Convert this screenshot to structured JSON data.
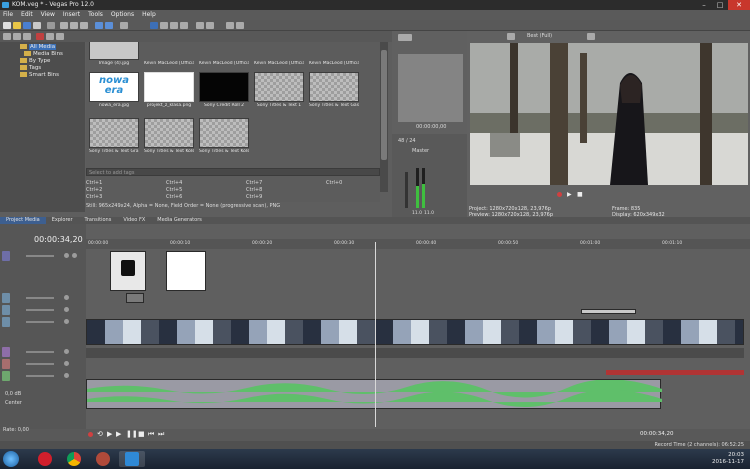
{
  "window": {
    "title": "KOM.veg * - Vegas Pro 12.0"
  },
  "menu": [
    "File",
    "Edit",
    "View",
    "Insert",
    "Tools",
    "Options",
    "Help"
  ],
  "explorer": {
    "tree": [
      {
        "label": "All Media",
        "selected": true
      },
      {
        "label": "Media Bins"
      },
      {
        "label": "By Type"
      },
      {
        "label": "Tags"
      },
      {
        "label": "Smart Bins"
      }
    ],
    "media": [
      {
        "caption": "Image (4).jpg",
        "kind": "photo"
      },
      {
        "caption": "Kevin MacLeod [Official] - Professor Umlaut - inco...",
        "kind": "audio"
      },
      {
        "caption": "Kevin MacLeod [Official] - Professor Umlaut - inco...",
        "kind": "audio"
      },
      {
        "caption": "Kevin MacLeod [Official] - Kyrsa's Theme - incomp...",
        "kind": "audio"
      },
      {
        "caption": "Kevin MacLeod [Official] - Kyrsa's Theme - incomp...",
        "kind": "audio"
      },
      {
        "caption": "nowa_era.jpg",
        "kind": "logo"
      },
      {
        "caption": "projekt_z_klasa.png",
        "kind": "white"
      },
      {
        "caption": "Sony Credit Roll 2",
        "kind": "black"
      },
      {
        "caption": "Sony Titles & Text 1",
        "kind": "checker"
      },
      {
        "caption": "Sony Titles & Text Gasi rady?",
        "kind": "checker"
      },
      {
        "caption": "Sony Titles & Text Gra Miejska",
        "kind": "checker"
      },
      {
        "caption": "Sony Titles & Text Kolska",
        "kind": "checker"
      },
      {
        "caption": "Sony Titles & Text Kolska",
        "kind": "checker"
      }
    ],
    "logo_text": "nowa\nera",
    "tags_placeholder": "Select to add tags",
    "hotkeys": [
      "Ctrl+1",
      "Ctrl+2",
      "Ctrl+3",
      "Ctrl+4",
      "Ctrl+5",
      "Ctrl+6",
      "Ctrl+7",
      "Ctrl+8",
      "Ctrl+9",
      "Ctrl+0"
    ],
    "file_info": "Still: 965x249x24, Alpha = None, Field Order = None (progressive scan), PNG"
  },
  "bottom_tabs": [
    "Project Media",
    "Explorer",
    "Transitions",
    "Video FX",
    "Media Generators"
  ],
  "trimmer": {
    "timecode": "00:00:00,00",
    "track_label": "48 / 24",
    "master": "Master",
    "meter_left": "11.0",
    "meter_right": "11.0"
  },
  "preview": {
    "quality": "Best (Full)",
    "project": "Project:  1280x720x128, 23,976p",
    "preview_res": "Preview:  1280x720x128, 23,976p",
    "frame": "Frame:      835",
    "display": "Display:    620x349x32"
  },
  "timeline": {
    "timecode": "00:00:34,20",
    "ruler": [
      "00:00:00",
      "00:00:10",
      "00:00:20",
      "00:00:30",
      "00:00:40",
      "00:00:50",
      "00:01:00",
      "00:01:10"
    ],
    "vol_label": "0,0 dB",
    "pan_label": "Center",
    "rate": "Rate: 0,00",
    "end_time": "00:00:34,20",
    "record_time": "Record Time (2 channels): 06:52:25"
  },
  "taskbar": {
    "time": "20:03",
    "date": "2016-11-17"
  }
}
